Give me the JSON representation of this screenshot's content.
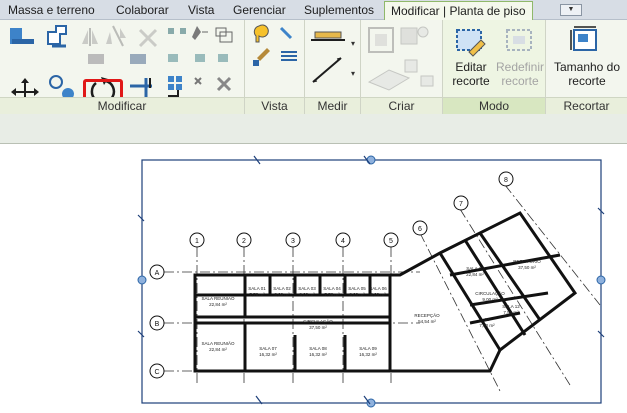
{
  "tabs": [
    {
      "label": "Massa e terreno"
    },
    {
      "label": "Colaborar"
    },
    {
      "label": "Vista"
    },
    {
      "label": "Gerenciar"
    },
    {
      "label": "Suplementos"
    },
    {
      "label": "Modificar | Planta de piso",
      "active": true
    }
  ],
  "ribbon": {
    "panels": {
      "modificar": "Modificar",
      "vista": "Vista",
      "medir": "Medir",
      "criar": "Criar",
      "modo": "Modo",
      "recortar": "Recortar"
    },
    "buttons": {
      "editar_recorte_l1": "Editar",
      "editar_recorte_l2": "recorte",
      "redefinir_recorte_l1": "Redefinir",
      "redefinir_recorte_l2": "recorte",
      "tamanho_recorte_l1": "Tamanho do",
      "tamanho_recorte_l2": "recorte"
    },
    "highlighted_tool": "rotate-icon",
    "highlight_color": "#e01818"
  },
  "drawing": {
    "grid_numbers": [
      "1",
      "2",
      "3",
      "4",
      "5",
      "6",
      "7",
      "8"
    ],
    "grid_letters": [
      "A",
      "B",
      "C"
    ],
    "rooms": {
      "sala_reuniao_1": "SALA REUNIÃO",
      "sala_reuniao_1_area": "22,84 m²",
      "sala_reuniao_2": "SALA REUNIÃO",
      "sala_reuniao_2_area": "22,84 m²",
      "sala01": "SALA 01",
      "sala01_area": "7,76 m²",
      "sala02": "SALA 02",
      "sala02_area": "8,00 m²",
      "sala03": "SALA 03",
      "sala03_area": "8,00 m²",
      "sala04": "SALA 04",
      "sala04_area": "7,76 m²",
      "sala05": "SALA 05",
      "sala05_area": "8,00 m²",
      "sala06": "SALA 06",
      "sala06_area": "8,00 m²",
      "sala07": "SALA 07",
      "sala07_area": "16,32 m²",
      "sala08": "SALA 08",
      "sala08_area": "16,32 m²",
      "sala09": "SALA 09",
      "sala09_area": "16,32 m²",
      "circulacao_1": "CIRCULAÇÃO",
      "circulacao_1_area": "37,50 m²",
      "circulacao_2": "CIRCULAÇÃO",
      "circulacao_2_area": "9,00 m²",
      "recepcao": "RECEPÇÃO",
      "recepcao_area": "54,54 m²",
      "sala10": "SALA 10",
      "sala10_area": "22,84 m²",
      "refeitorio": "REFEITÓRIO",
      "refeitorio_area": "37,50 m²",
      "sala11": "11",
      "sala11_area": "7,50 m²",
      "sala12": "SALA 12",
      "sala12_area": "7,50 m²"
    }
  }
}
